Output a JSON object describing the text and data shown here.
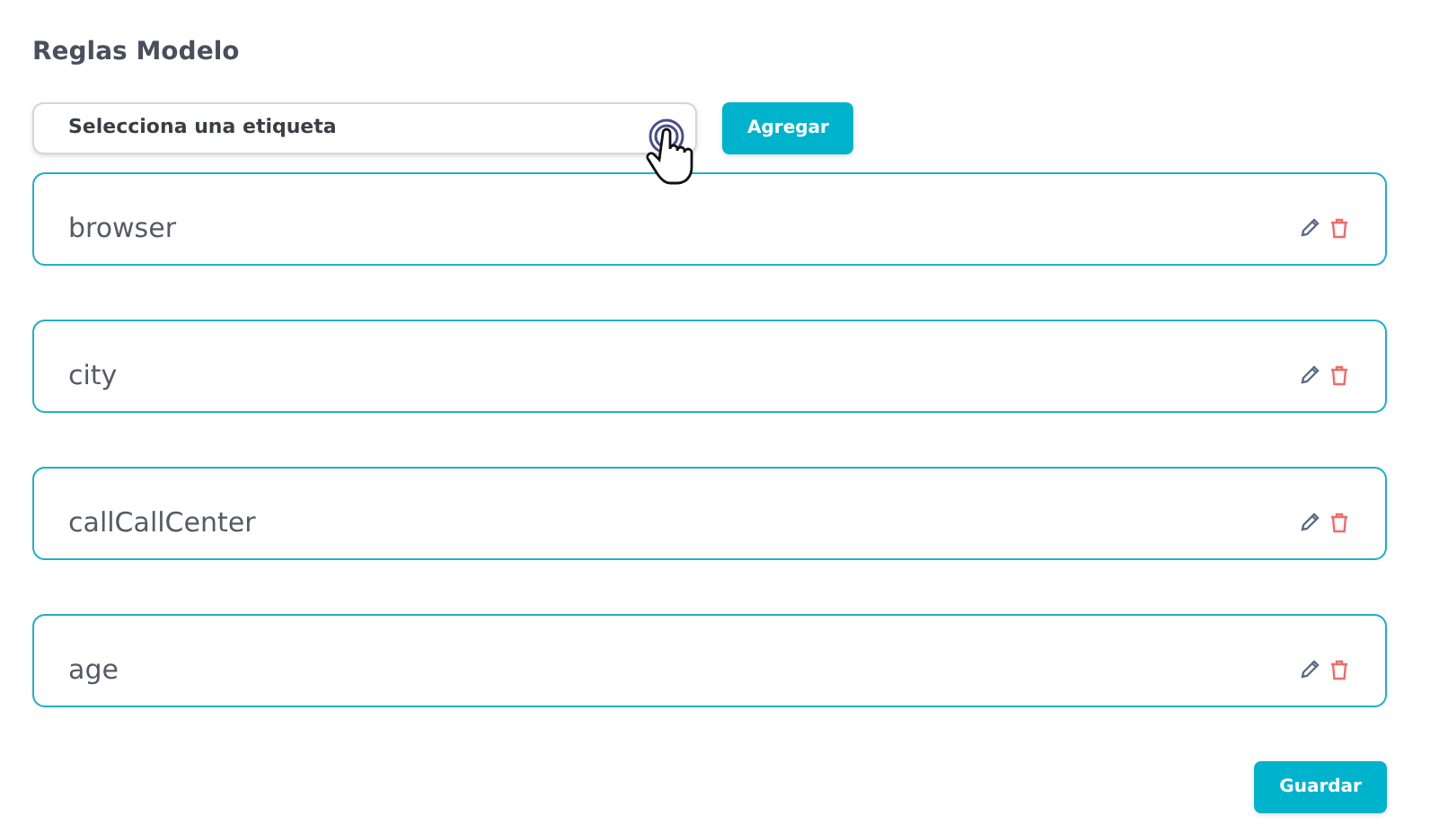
{
  "title": "Reglas Modelo",
  "select": {
    "placeholder": "Selecciona una etiqueta"
  },
  "add_button": "Agregar",
  "rules": [
    {
      "name": "browser"
    },
    {
      "name": "city"
    },
    {
      "name": "callCallCenter"
    },
    {
      "name": "age"
    }
  ],
  "save_button": "Guardar"
}
